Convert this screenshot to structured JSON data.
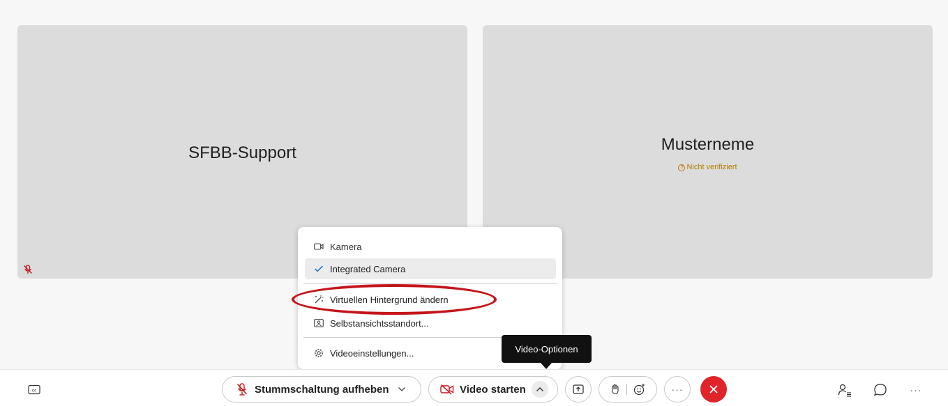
{
  "participants": [
    {
      "name": "SFBB-Support",
      "muted": true
    },
    {
      "name": "Musterneme",
      "status": "Nicht verifiziert"
    }
  ],
  "video_menu": {
    "section_label": "Kamera",
    "items": [
      {
        "label": "Integrated Camera",
        "selected": true
      },
      {
        "label": "Virtuellen Hintergrund ändern",
        "highlighted": true
      },
      {
        "label": "Selbstansichtsstandort..."
      },
      {
        "label": "Videoeinstellungen..."
      }
    ]
  },
  "tooltip": "Video-Optionen",
  "toolbar": {
    "unmute_label": "Stummschaltung aufheben",
    "video_label": "Video starten",
    "more_label": "···"
  },
  "colors": {
    "end_call": "#e0242a",
    "muted_icon": "#c4161c",
    "warning_text": "#b37b00",
    "highlight_ring": "#c4161c"
  }
}
